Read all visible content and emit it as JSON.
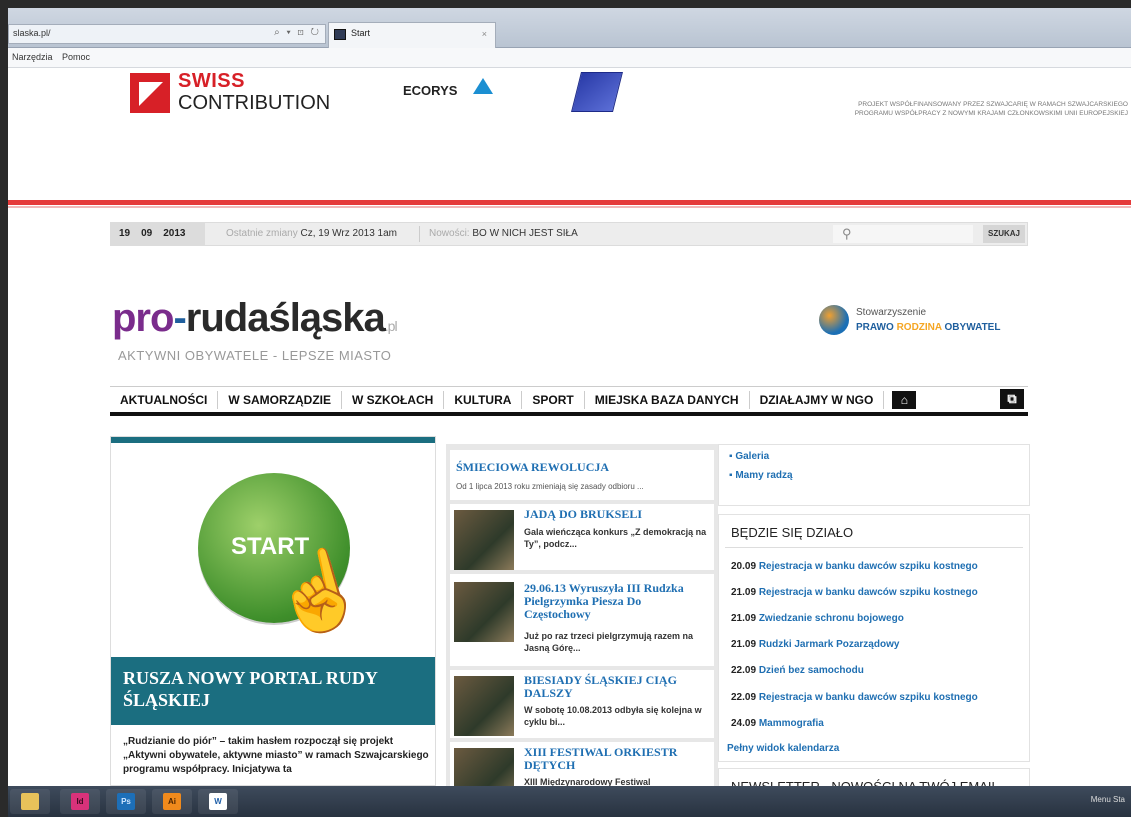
{
  "browser": {
    "address": "slaska.pl/",
    "address_controls": "⌕ ▾ ⊡ ↻",
    "tab_title": "Start",
    "tab_close": "×",
    "menu": [
      "Narzędzia",
      "Pomoc"
    ]
  },
  "header": {
    "swiss_line1": "SWISS",
    "swiss_line2": "CONTRIBUTION",
    "ecorys": "ECORYS",
    "project_line1": "PROJEKT WSPÓŁFINANSOWANY PRZEZ SZWAJCARIĘ W RAMACH SZWAJCARSKIEGO",
    "project_line2": "PROGRAMU WSPÓŁPRACY Z NOWYMI KRAJAMI CZŁONKOWSKIMI UNII EUROPEJSKIEJ"
  },
  "infobar": {
    "day": "19",
    "month": "09",
    "year": "2013",
    "changes_label": "Ostatnie zmiany",
    "changes_value": "Cz, 19 Wrz 2013 1am",
    "news_label": "Nowości:",
    "news_value": "BO W NICH JEST SIŁA",
    "search_button": "SZUKAJ"
  },
  "logo": {
    "pro": "pro",
    "dash": "-",
    "name": "rudaśląska",
    "tld": ".pl",
    "tagline": "AKTYWNI OBYWATELE - LEPSZE MIASTO",
    "assoc_line1": "Stowarzyszenie",
    "assoc_w1": "PRAWO",
    "assoc_w2": "RODZINA",
    "assoc_w3": "OBYWATEL"
  },
  "nav": {
    "items": [
      "AKTUALNOŚCI",
      "W SAMORZĄDZIE",
      "W SZKOŁACH",
      "KULTURA",
      "SPORT",
      "MIEJSKA BAZA DANYCH",
      "DZIAŁAJMY W NGO"
    ]
  },
  "teaser": {
    "button_label": "START",
    "title": "RUSZA NOWY PORTAL RUDY ŚLĄSKIEJ",
    "text": "„Rudzianie do piór” – takim hasłem rozpoczął się projekt „Aktywni obywatele, aktywne miasto” w ramach Szwajcarskiego programu współpracy. Inicjatywa ta"
  },
  "middle": {
    "head_title": "ŚMIECIOWA REWOLUCJA",
    "head_text": "Od 1 lipca 2013 roku zmieniają się zasady odbioru ...",
    "stories": [
      {
        "title": "JADĄ DO BRUKSELI",
        "text": "Gala wieńcząca konkurs „Z demokracją na Ty”, podcz..."
      },
      {
        "title": "29.06.13 Wyruszyła III Rudzka Pielgrzymka Piesza Do Częstochowy",
        "text": "Już po raz trzeci pielgrzymują razem na Jasną Górę..."
      },
      {
        "title": "BIESIADY ŚLĄSKIEJ CIĄG DALSZY",
        "text": "W sobotę 10.08.2013 odbyła się kolejna w cyklu bi..."
      },
      {
        "title": "XIII FESTIWAL ORKIESTR DĘTYCH",
        "text": "XIII Międzynarodowy Festiwal"
      }
    ]
  },
  "right": {
    "links": [
      "Galeria",
      "Mamy radzą"
    ],
    "events_title": "BĘDZIE SIĘ DZIAŁO",
    "events": [
      {
        "date": "20.09",
        "name": "Rejestracja w banku dawców szpiku kostnego"
      },
      {
        "date": "21.09",
        "name": "Rejestracja w banku dawców szpiku kostnego"
      },
      {
        "date": "21.09",
        "name": "Zwiedzanie schronu bojowego"
      },
      {
        "date": "21.09",
        "name": "Rudzki Jarmark Pozarządowy"
      },
      {
        "date": "22.09",
        "name": "Dzień bez samochodu"
      },
      {
        "date": "22.09",
        "name": "Rejestracja w banku dawców szpiku kostnego"
      },
      {
        "date": "24.09",
        "name": "Mammografia"
      }
    ],
    "events_all": "Pełny widok kalendarza",
    "newsletter": "NEWSLETTER - NOWOŚCI NA TWÓJ EMAIL"
  },
  "taskbar": {
    "apps": [
      {
        "icon": "folder-icon",
        "label": ""
      },
      {
        "icon": "indesign-icon",
        "label": "Id"
      },
      {
        "icon": "photoshop-icon",
        "label": "Ps"
      },
      {
        "icon": "illustrator-icon",
        "label": "Ai"
      },
      {
        "icon": "word-icon",
        "label": "W"
      }
    ],
    "menu_label": "Menu Sta"
  },
  "colors": {
    "swiss_red": "#d72027",
    "link_blue": "#1f6fb2",
    "teal": "#1b6e80",
    "accent_red_line": "#e53a3a",
    "logo_purple": "#7a2c8c"
  }
}
